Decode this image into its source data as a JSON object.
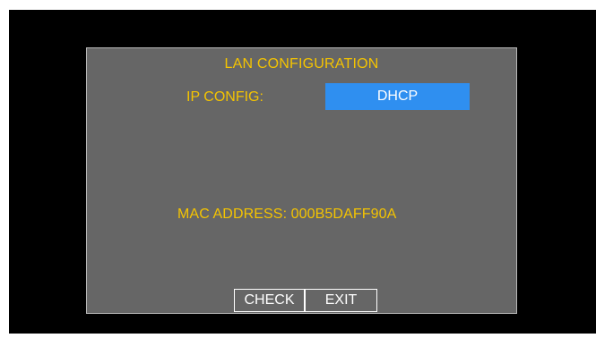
{
  "dialog": {
    "title": "LAN CONFIGURATION",
    "ip_config_label": "IP CONFIG:",
    "ip_config_value": "DHCP",
    "mac_address": "MAC ADDRESS: 000B5DAFF90A"
  },
  "buttons": {
    "check_label": "CHECK",
    "exit_label": "EXIT"
  },
  "colors": {
    "screen_bg": "#000000",
    "dialog_bg": "#666666",
    "label_text": "#f5c400",
    "selection_bg": "#2f8ff0",
    "button_text": "#ffffff"
  }
}
